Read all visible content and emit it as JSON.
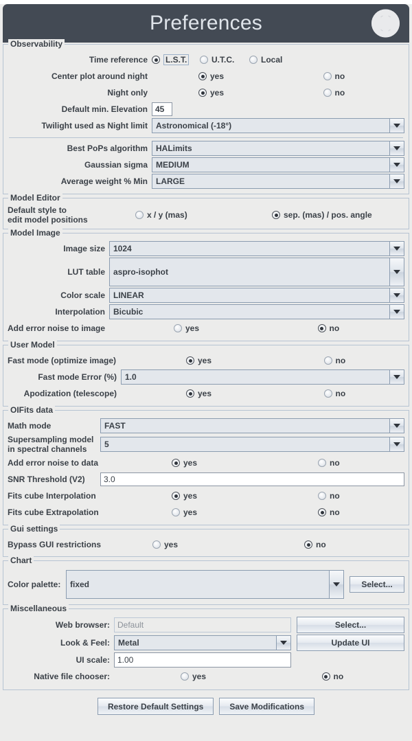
{
  "window": {
    "title": "Preferences",
    "busy_icon": "circle-indicator-icon"
  },
  "groups": {
    "observability": {
      "title": "Observability",
      "time_reference": {
        "label": "Time reference",
        "options": [
          "L.S.T.",
          "U.T.C.",
          "Local"
        ],
        "selected": "L.S.T."
      },
      "center_plot": {
        "label": "Center plot around night",
        "yes": "yes",
        "no": "no",
        "selected": "yes"
      },
      "night_only": {
        "label": "Night only",
        "yes": "yes",
        "no": "no",
        "selected": "yes"
      },
      "min_elevation": {
        "label": "Default min. Elevation",
        "value": "45"
      },
      "twilight": {
        "label": "Twilight used as Night limit",
        "value": "Astronomical (-18°)"
      },
      "pops_algorithm": {
        "label": "Best PoPs algorithm",
        "value": "HALimits"
      },
      "gaussian_sigma": {
        "label": "Gaussian sigma",
        "value": "MEDIUM"
      },
      "average_weight": {
        "label": "Average weight % Min",
        "value": "LARGE"
      }
    },
    "model_editor": {
      "title": "Model Editor",
      "default_style": {
        "label_line1": "Default style to",
        "label_line2": "edit model positions",
        "option_a": "x / y (mas)",
        "option_b": "sep. (mas) / pos. angle",
        "selected": "sep. (mas) / pos. angle"
      }
    },
    "model_image": {
      "title": "Model Image",
      "image_size": {
        "label": "Image size",
        "value": "1024"
      },
      "lut_table": {
        "label": "LUT table",
        "value": "aspro-isophot"
      },
      "color_scale": {
        "label": "Color scale",
        "value": "LINEAR"
      },
      "interpolation": {
        "label": "Interpolation",
        "value": "Bicubic"
      },
      "error_noise": {
        "label": "Add error noise to image",
        "yes": "yes",
        "no": "no",
        "selected": "no"
      }
    },
    "user_model": {
      "title": "User Model",
      "fast_mode": {
        "label": "Fast mode (optimize image)",
        "yes": "yes",
        "no": "no",
        "selected": "yes"
      },
      "fast_mode_error": {
        "label": "Fast mode Error (%)",
        "value": "1.0"
      },
      "apodization": {
        "label": "Apodization (telescope)",
        "yes": "yes",
        "no": "no",
        "selected": "yes"
      }
    },
    "oifits_data": {
      "title": "OIFits data",
      "math_mode": {
        "label": "Math mode",
        "value": "FAST"
      },
      "supersampling": {
        "label_line1": "Supersampling model",
        "label_line2": "in spectral channels",
        "value": "5"
      },
      "error_noise": {
        "label": "Add error noise to data",
        "yes": "yes",
        "no": "no",
        "selected": "yes"
      },
      "snr_threshold": {
        "label": "SNR Threshold (V2)",
        "value": "3.0"
      },
      "cube_interpolation": {
        "label": "Fits cube Interpolation",
        "yes": "yes",
        "no": "no",
        "selected": "yes"
      },
      "cube_extrapolation": {
        "label": "Fits cube Extrapolation",
        "yes": "yes",
        "no": "no",
        "selected": "no"
      }
    },
    "gui_settings": {
      "title": "Gui settings",
      "bypass": {
        "label": "Bypass GUI restrictions",
        "yes": "yes",
        "no": "no",
        "selected": "no"
      }
    },
    "chart": {
      "title": "Chart",
      "color_palette": {
        "label": "Color palette:",
        "value": "fixed",
        "select_button": "Select..."
      }
    },
    "miscellaneous": {
      "title": "Miscellaneous",
      "web_browser": {
        "label": "Web browser:",
        "value": "Default",
        "select_button": "Select..."
      },
      "look_and_feel": {
        "label": "Look & Feel:",
        "value": "Metal",
        "update_button": "Update UI"
      },
      "ui_scale": {
        "label": "UI scale:",
        "value": "1.00"
      },
      "native_file_chooser": {
        "label": "Native file chooser:",
        "yes": "yes",
        "no": "no",
        "selected": "no"
      }
    }
  },
  "footer": {
    "restore_label": "Restore Default Settings",
    "save_label": "Save Modifications"
  },
  "colors": {
    "titlebar_bg": "#434a54",
    "titlebar_text": "#dfe4ea",
    "panel_bg": "#ececeb",
    "border": "#b6c3d2",
    "combo_bg": "#e3e7ec",
    "text": "#3b4148"
  }
}
